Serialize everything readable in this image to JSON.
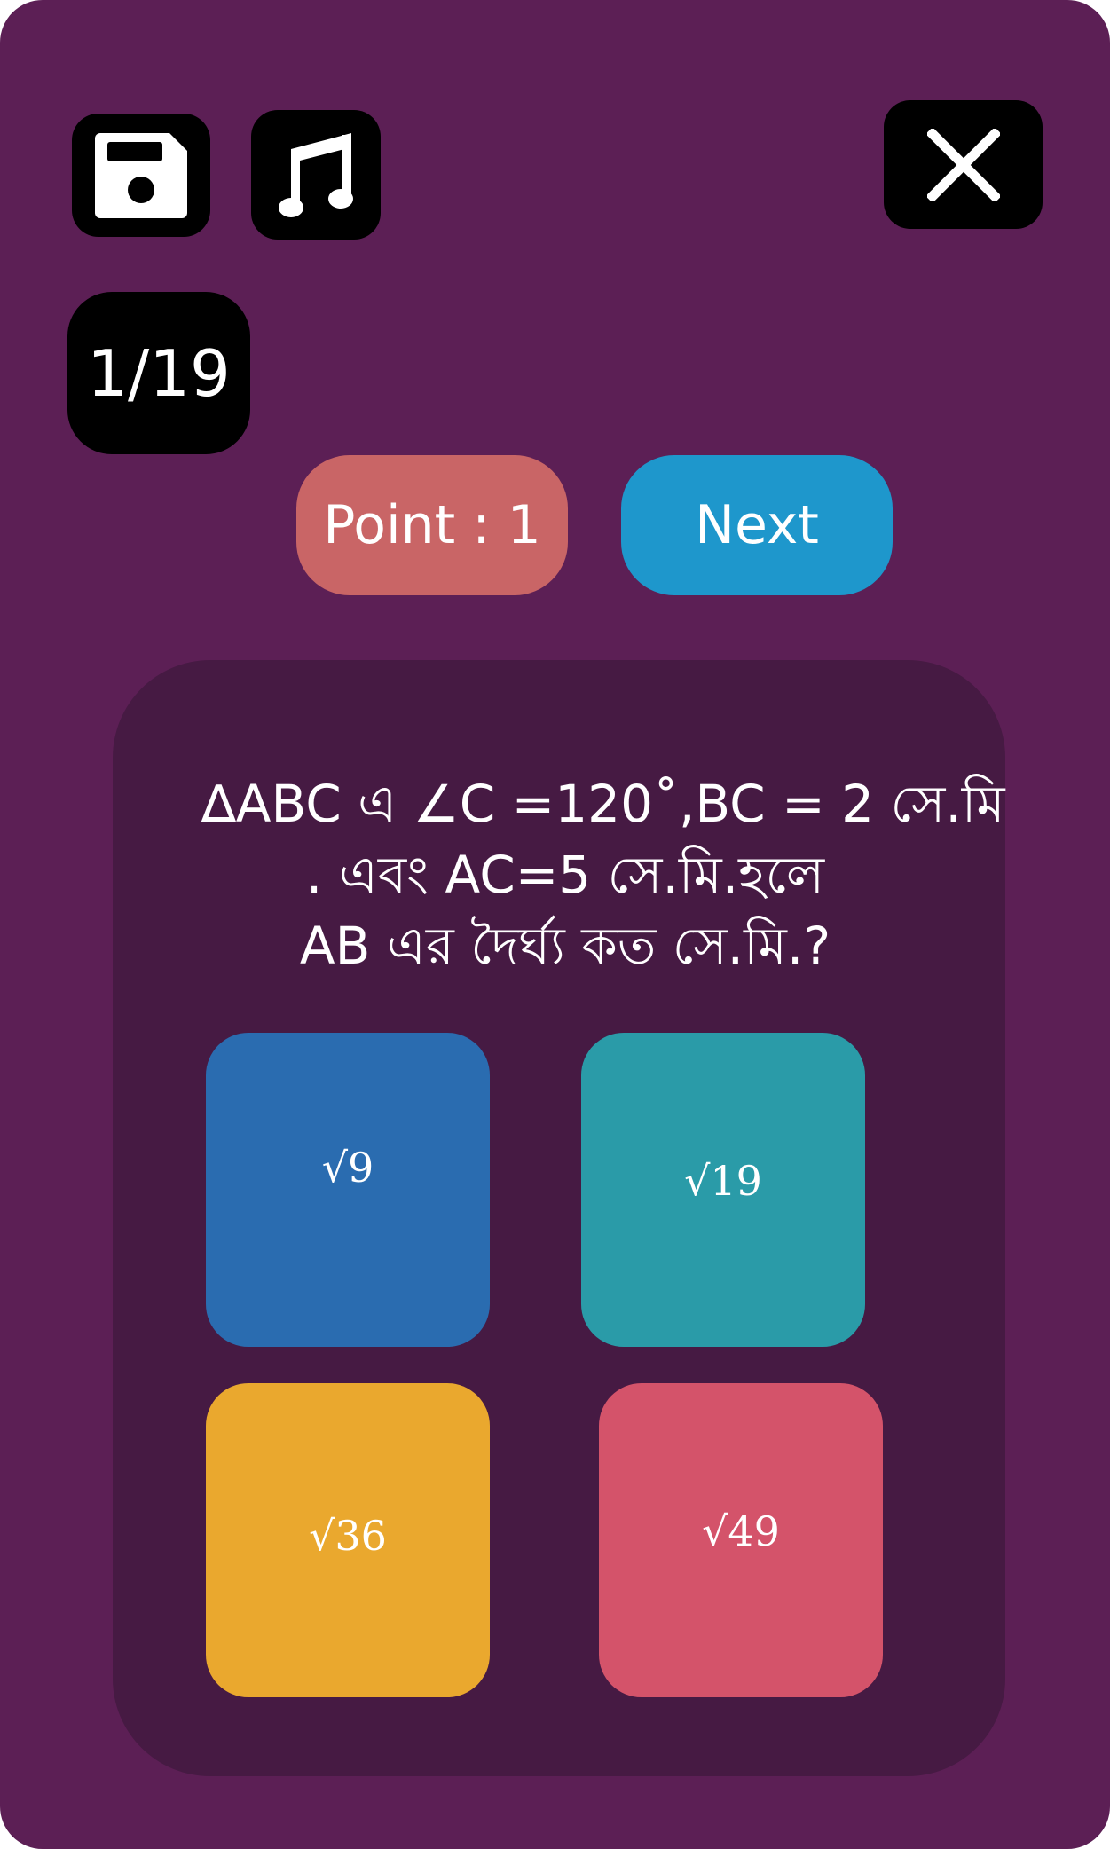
{
  "toolbar": {
    "save_icon": "floppy-disk-icon",
    "music_icon": "music-note-icon",
    "close_icon": "close-x-icon"
  },
  "progress": {
    "counter": "1/19"
  },
  "score": {
    "point_label": "Point : 1"
  },
  "navigation": {
    "next_label": "Next"
  },
  "question": {
    "line1": "∆ABC এ ∠C =120˚,BC = 2 সে.মি",
    "line2": ". এবং AC=5 সে.মি.হলে",
    "line3": "AB এর দৈর্ঘ্য কত সে.মি.?"
  },
  "answers": [
    {
      "label": "√9",
      "color": "#2a6cb0"
    },
    {
      "label": "√19",
      "color": "#2a9ba8"
    },
    {
      "label": "√36",
      "color": "#eaa82e"
    },
    {
      "label": "√49",
      "color": "#d4536a"
    }
  ],
  "colors": {
    "background": "#5c1f55",
    "panel": "#461a43",
    "point": "#c96566",
    "next": "#1e97cc"
  }
}
